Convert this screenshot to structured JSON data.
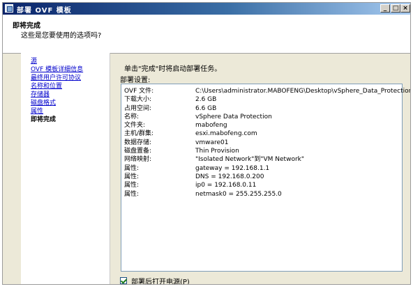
{
  "window": {
    "title": "部署 OVF 模板",
    "controls": {
      "minimize": "_",
      "maximize": "□",
      "close": "×"
    }
  },
  "header": {
    "title": "即将完成",
    "subtitle": "这些是您要使用的选项吗?"
  },
  "nav": {
    "items": [
      {
        "label": "源",
        "current": false
      },
      {
        "label": "OVF 模板详细信息",
        "current": false
      },
      {
        "label": "最终用户许可协议",
        "current": false
      },
      {
        "label": "名称和位置",
        "current": false
      },
      {
        "label": "存储器",
        "current": false
      },
      {
        "label": "磁盘格式",
        "current": false
      },
      {
        "label": "属性",
        "current": false
      },
      {
        "label": "即将完成",
        "current": true
      }
    ]
  },
  "main": {
    "intro": "单击\"完成\"时将启动部署任务。",
    "settings_label": "部署设置:",
    "settings": [
      {
        "key": "OVF 文件:",
        "value": "C:\\Users\\administrator.MABOFENG\\Desktop\\vSphere_Data_Protection_-_..."
      },
      {
        "key": "下载大小:",
        "value": "2.6 GB"
      },
      {
        "key": "占用空间:",
        "value": "6.6 GB"
      },
      {
        "key": "名称:",
        "value": "vSphere Data Protection"
      },
      {
        "key": "文件夹:",
        "value": "mabofeng"
      },
      {
        "key": "主机/群集:",
        "value": "esxi.mabofeng.com"
      },
      {
        "key": "数据存储:",
        "value": "vmware01"
      },
      {
        "key": "磁盘置备:",
        "value": "Thin Provision"
      },
      {
        "key": "网络映射:",
        "value": "\"Isolated Network\"到\"VM Network\""
      },
      {
        "key": "属性:",
        "value": "gateway = 192.168.1.1"
      },
      {
        "key": "属性:",
        "value": "DNS = 192.168.0.200"
      },
      {
        "key": "属性:",
        "value": "ip0 = 192.168.0.11"
      },
      {
        "key": "属性:",
        "value": "netmask0 = 255.255.255.0"
      }
    ],
    "power_on_checkbox": {
      "label": "部署后打开电源(P)",
      "checked": true
    }
  }
}
